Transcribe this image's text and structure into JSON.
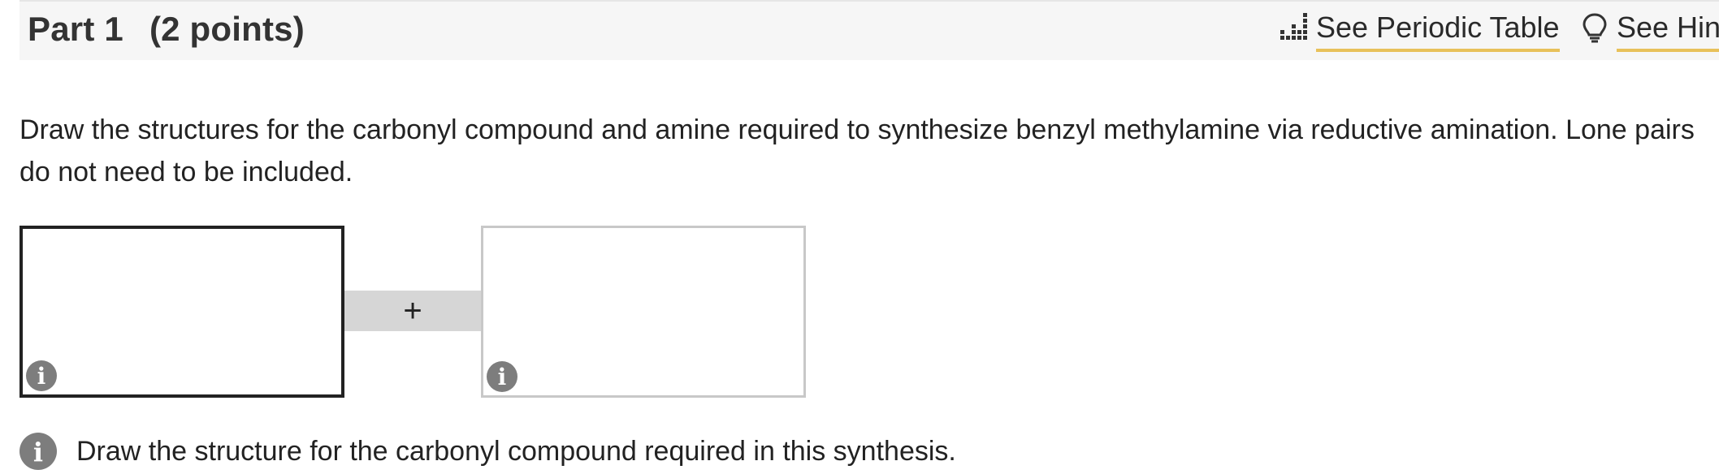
{
  "header": {
    "part_label": "Part 1",
    "points_label": "(2 points)",
    "periodic_table_link": "See Periodic Table",
    "hint_link": "See Hin",
    "periodic_icon": "periodic-table-icon",
    "hint_icon": "lightbulb-icon",
    "accent_color": "#e8c15a"
  },
  "question": {
    "text": "Draw the structures for the carbonyl compound and amine required to synthesize benzyl methylamine via reductive amination. Lone pairs do not need to be included."
  },
  "drawing": {
    "connector_symbol": "+",
    "info_glyph": "i"
  },
  "footer": {
    "info_text": "Draw the structure for the carbonyl compound required in this synthesis."
  }
}
